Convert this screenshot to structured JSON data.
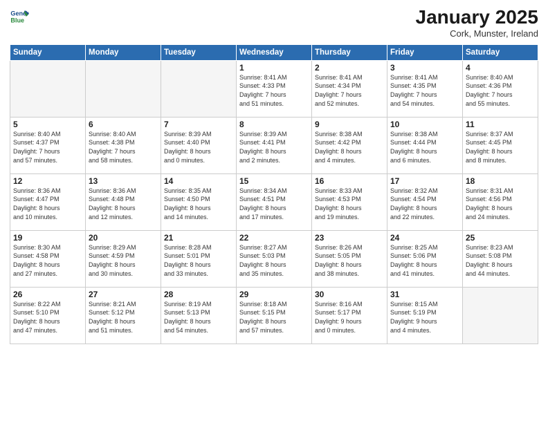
{
  "header": {
    "logo_line1": "General",
    "logo_line2": "Blue",
    "month": "January 2025",
    "location": "Cork, Munster, Ireland"
  },
  "days_of_week": [
    "Sunday",
    "Monday",
    "Tuesday",
    "Wednesday",
    "Thursday",
    "Friday",
    "Saturday"
  ],
  "weeks": [
    [
      {
        "day": "",
        "info": ""
      },
      {
        "day": "",
        "info": ""
      },
      {
        "day": "",
        "info": ""
      },
      {
        "day": "1",
        "info": "Sunrise: 8:41 AM\nSunset: 4:33 PM\nDaylight: 7 hours\nand 51 minutes."
      },
      {
        "day": "2",
        "info": "Sunrise: 8:41 AM\nSunset: 4:34 PM\nDaylight: 7 hours\nand 52 minutes."
      },
      {
        "day": "3",
        "info": "Sunrise: 8:41 AM\nSunset: 4:35 PM\nDaylight: 7 hours\nand 54 minutes."
      },
      {
        "day": "4",
        "info": "Sunrise: 8:40 AM\nSunset: 4:36 PM\nDaylight: 7 hours\nand 55 minutes."
      }
    ],
    [
      {
        "day": "5",
        "info": "Sunrise: 8:40 AM\nSunset: 4:37 PM\nDaylight: 7 hours\nand 57 minutes."
      },
      {
        "day": "6",
        "info": "Sunrise: 8:40 AM\nSunset: 4:38 PM\nDaylight: 7 hours\nand 58 minutes."
      },
      {
        "day": "7",
        "info": "Sunrise: 8:39 AM\nSunset: 4:40 PM\nDaylight: 8 hours\nand 0 minutes."
      },
      {
        "day": "8",
        "info": "Sunrise: 8:39 AM\nSunset: 4:41 PM\nDaylight: 8 hours\nand 2 minutes."
      },
      {
        "day": "9",
        "info": "Sunrise: 8:38 AM\nSunset: 4:42 PM\nDaylight: 8 hours\nand 4 minutes."
      },
      {
        "day": "10",
        "info": "Sunrise: 8:38 AM\nSunset: 4:44 PM\nDaylight: 8 hours\nand 6 minutes."
      },
      {
        "day": "11",
        "info": "Sunrise: 8:37 AM\nSunset: 4:45 PM\nDaylight: 8 hours\nand 8 minutes."
      }
    ],
    [
      {
        "day": "12",
        "info": "Sunrise: 8:36 AM\nSunset: 4:47 PM\nDaylight: 8 hours\nand 10 minutes."
      },
      {
        "day": "13",
        "info": "Sunrise: 8:36 AM\nSunset: 4:48 PM\nDaylight: 8 hours\nand 12 minutes."
      },
      {
        "day": "14",
        "info": "Sunrise: 8:35 AM\nSunset: 4:50 PM\nDaylight: 8 hours\nand 14 minutes."
      },
      {
        "day": "15",
        "info": "Sunrise: 8:34 AM\nSunset: 4:51 PM\nDaylight: 8 hours\nand 17 minutes."
      },
      {
        "day": "16",
        "info": "Sunrise: 8:33 AM\nSunset: 4:53 PM\nDaylight: 8 hours\nand 19 minutes."
      },
      {
        "day": "17",
        "info": "Sunrise: 8:32 AM\nSunset: 4:54 PM\nDaylight: 8 hours\nand 22 minutes."
      },
      {
        "day": "18",
        "info": "Sunrise: 8:31 AM\nSunset: 4:56 PM\nDaylight: 8 hours\nand 24 minutes."
      }
    ],
    [
      {
        "day": "19",
        "info": "Sunrise: 8:30 AM\nSunset: 4:58 PM\nDaylight: 8 hours\nand 27 minutes."
      },
      {
        "day": "20",
        "info": "Sunrise: 8:29 AM\nSunset: 4:59 PM\nDaylight: 8 hours\nand 30 minutes."
      },
      {
        "day": "21",
        "info": "Sunrise: 8:28 AM\nSunset: 5:01 PM\nDaylight: 8 hours\nand 33 minutes."
      },
      {
        "day": "22",
        "info": "Sunrise: 8:27 AM\nSunset: 5:03 PM\nDaylight: 8 hours\nand 35 minutes."
      },
      {
        "day": "23",
        "info": "Sunrise: 8:26 AM\nSunset: 5:05 PM\nDaylight: 8 hours\nand 38 minutes."
      },
      {
        "day": "24",
        "info": "Sunrise: 8:25 AM\nSunset: 5:06 PM\nDaylight: 8 hours\nand 41 minutes."
      },
      {
        "day": "25",
        "info": "Sunrise: 8:23 AM\nSunset: 5:08 PM\nDaylight: 8 hours\nand 44 minutes."
      }
    ],
    [
      {
        "day": "26",
        "info": "Sunrise: 8:22 AM\nSunset: 5:10 PM\nDaylight: 8 hours\nand 47 minutes."
      },
      {
        "day": "27",
        "info": "Sunrise: 8:21 AM\nSunset: 5:12 PM\nDaylight: 8 hours\nand 51 minutes."
      },
      {
        "day": "28",
        "info": "Sunrise: 8:19 AM\nSunset: 5:13 PM\nDaylight: 8 hours\nand 54 minutes."
      },
      {
        "day": "29",
        "info": "Sunrise: 8:18 AM\nSunset: 5:15 PM\nDaylight: 8 hours\nand 57 minutes."
      },
      {
        "day": "30",
        "info": "Sunrise: 8:16 AM\nSunset: 5:17 PM\nDaylight: 9 hours\nand 0 minutes."
      },
      {
        "day": "31",
        "info": "Sunrise: 8:15 AM\nSunset: 5:19 PM\nDaylight: 9 hours\nand 4 minutes."
      },
      {
        "day": "",
        "info": ""
      }
    ]
  ]
}
